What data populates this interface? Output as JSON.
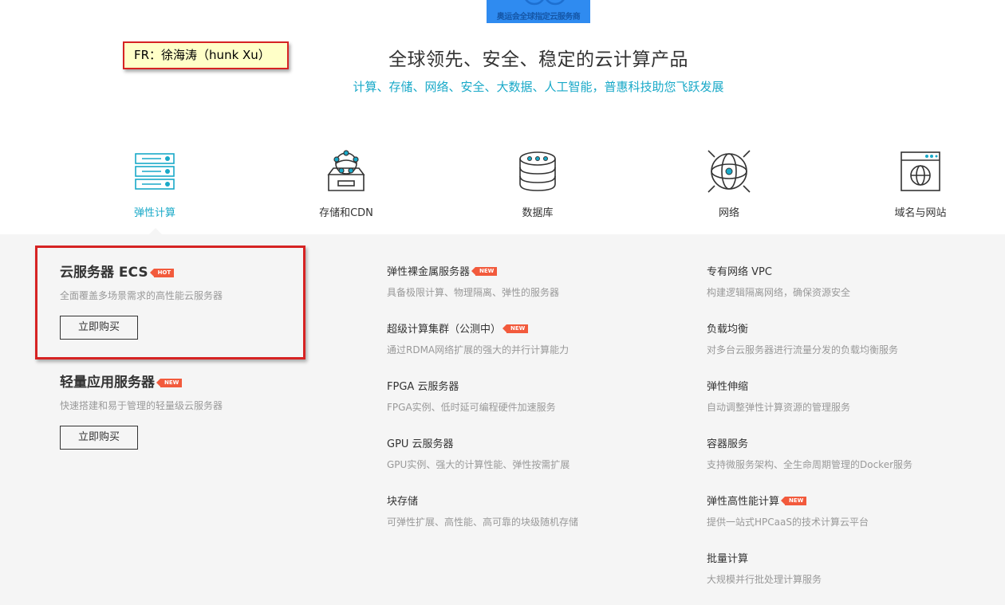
{
  "banner": {
    "text": "奥运会全球指定云服务商"
  },
  "annotation": {
    "text": "FR：徐海涛（hunk Xu）"
  },
  "hero": {
    "title": "全球领先、安全、稳定的云计算产品",
    "subtitle": "计算、存储、网络、安全、大数据、人工智能，普惠科技助您飞跃发展"
  },
  "tabs": [
    {
      "label": "弹性计算",
      "icon": "server-rack-icon",
      "active": true
    },
    {
      "label": "存储和CDN",
      "icon": "storage-box-icon",
      "active": false
    },
    {
      "label": "数据库",
      "icon": "database-icon",
      "active": false
    },
    {
      "label": "网络",
      "icon": "globe-network-icon",
      "active": false
    },
    {
      "label": "域名与网站",
      "icon": "website-globe-icon",
      "active": false
    }
  ],
  "featured": [
    {
      "name": "云服务器 ECS",
      "badge": "HOT",
      "desc": "全面覆盖多场景需求的高性能云服务器",
      "button": "立即购买"
    },
    {
      "name": "轻量应用服务器",
      "badge": "NEW",
      "desc": "快速搭建和易于管理的轻量级云服务器",
      "button": "立即购买"
    }
  ],
  "column_middle": [
    {
      "name": "弹性裸金属服务器",
      "badge": "NEW",
      "desc": "具备极限计算、物理隔离、弹性的服务器"
    },
    {
      "name": "超级计算集群（公测中）",
      "badge": "NEW",
      "desc": "通过RDMA网络扩展的强大的并行计算能力"
    },
    {
      "name": "FPGA 云服务器",
      "badge": "",
      "desc": "FPGA实例、低时延可编程硬件加速服务"
    },
    {
      "name": "GPU 云服务器",
      "badge": "",
      "desc": "GPU实例、强大的计算性能、弹性按需扩展"
    },
    {
      "name": "块存储",
      "badge": "",
      "desc": "可弹性扩展、高性能、高可靠的块级随机存储"
    }
  ],
  "column_right": [
    {
      "name": "专有网络 VPC",
      "badge": "",
      "desc": "构建逻辑隔离网络，确保资源安全"
    },
    {
      "name": "负载均衡",
      "badge": "",
      "desc": "对多台云服务器进行流量分发的负载均衡服务"
    },
    {
      "name": "弹性伸缩",
      "badge": "",
      "desc": "自动调整弹性计算资源的管理服务"
    },
    {
      "name": "容器服务",
      "badge": "",
      "desc": "支持微服务架构、全生命周期管理的Docker服务"
    },
    {
      "name": "弹性高性能计算",
      "badge": "NEW",
      "desc": "提供一站式HPCaaS的技术计算云平台"
    },
    {
      "name": "批量计算",
      "badge": "",
      "desc": "大规模并行批处理计算服务"
    }
  ],
  "colors": {
    "accent": "#19a9c8",
    "badge": "#f25a3c",
    "annotation_border": "#d62323",
    "panel_bg": "#f5f5f5"
  }
}
